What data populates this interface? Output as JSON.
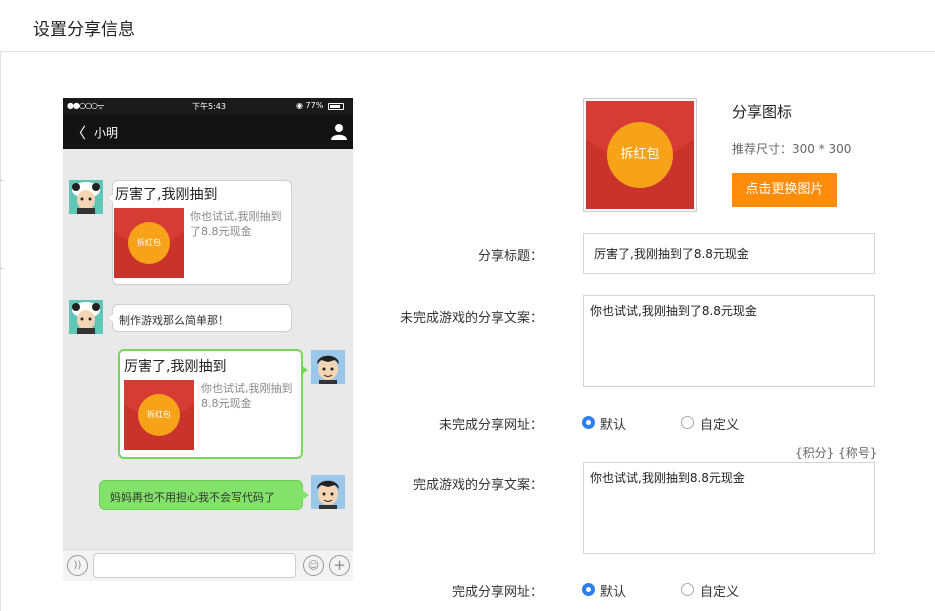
{
  "header": {
    "title": "设置分享信息"
  },
  "phone": {
    "status": {
      "signal": "●●○○○",
      "wifi": "ᯤ",
      "time": "下午5:43",
      "battery_text": "◉ 77%"
    },
    "nav": {
      "back": "〈",
      "contact_name": "小明"
    },
    "messages": [
      {
        "side": "left",
        "title": "厉害了,我刚抽到",
        "desc": "你也试试,我刚抽到了8.8元现金",
        "coin": "拆红包"
      },
      {
        "side": "left",
        "text": "制作游戏那么简单那！"
      },
      {
        "side": "right",
        "title": "厉害了,我刚抽到",
        "desc": "你也试试,我刚抽到8.8元现金",
        "coin": "拆红包"
      },
      {
        "side": "right",
        "text": "妈妈再也不用担心我不会写代码了"
      }
    ],
    "input_bar": {
      "voice": "))",
      "emoji": "☺",
      "plus": "+"
    }
  },
  "share_icon": {
    "coin_text": "拆红包",
    "title": "分享图标",
    "size_hint": "推荐尺寸：300 * 300",
    "change_button": "点击更换图片"
  },
  "form": {
    "share_title_label": "分享标题：",
    "share_title_value": "厉害了,我刚抽到了8.8元现金",
    "unfinished_copy_label": "未完成游戏的分享文案：",
    "unfinished_copy_value": "你也试试,我刚抽到了8.8元现金",
    "unfinished_url_label": "未完成分享网址：",
    "unfinished_url_options": [
      "默认",
      "自定义"
    ],
    "variable_hint": "{积分} {称号}",
    "finished_copy_label": "完成游戏的分享文案：",
    "finished_copy_value": "你也试试,我刚抽到8.8元现金",
    "finished_url_label": "完成分享网址：",
    "finished_url_options": [
      "默认",
      "自定义"
    ]
  },
  "colors": {
    "accent": "#ff8c0a",
    "radio_checked": "#2f7ef0",
    "bubble_green": "#82e26a",
    "redpack": "#c9332b",
    "coin": "#f6a31a"
  }
}
